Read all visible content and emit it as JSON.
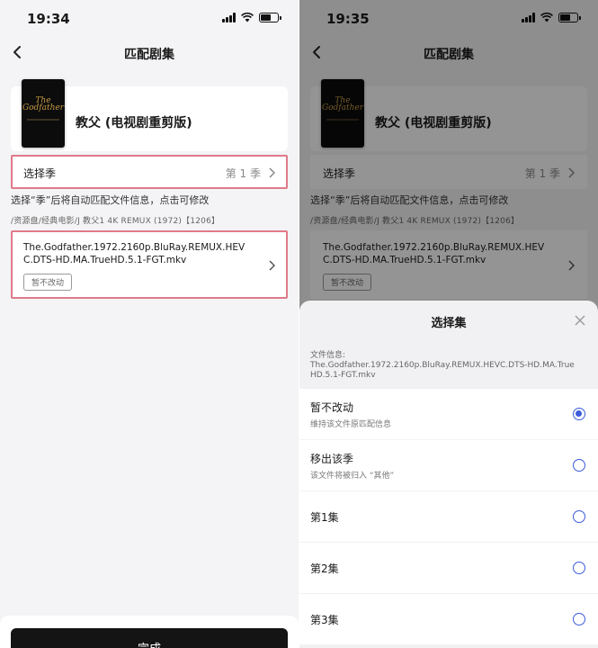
{
  "left": {
    "time": "19:34",
    "nav_title": "匹配剧集",
    "show_title": "教父 (电视剧重剪版)",
    "poster_text": "The Godfather",
    "season_label": "选择季",
    "season_value": "第 1 季",
    "hint": "选择“季”后将自动匹配文件信息，点击可修改",
    "path": "/资源盘/经典电影/J 教父1 4K REMUX (1972)【1206】",
    "filename": "The.Godfather.1972.2160p.BluRay.REMUX.HEVC.DTS-HD.MA.TrueHD.5.1-FGT.mkv",
    "file_badge": "暂不改动",
    "done_label": "完成"
  },
  "right": {
    "time": "19:35",
    "nav_title": "匹配剧集",
    "show_title": "教父 (电视剧重剪版)",
    "poster_text": "The Godfather",
    "season_label": "选择季",
    "season_value": "第 1 季",
    "hint": "选择“季”后将自动匹配文件信息，点击可修改",
    "path": "/资源盘/经典电影/J 教父1 4K REMUX (1972)【1206】",
    "filename": "The.Godfather.1972.2160p.BluRay.REMUX.HEVC.DTS-HD.MA.TrueHD.5.1-FGT.mkv",
    "file_badge": "暂不改动",
    "sheet": {
      "title": "选择集",
      "info_label": "文件信息:",
      "info_value": "The.Godfather.1972.2160p.BluRay.REMUX.HEVC.DTS-HD.MA.TrueHD.5.1-FGT.mkv",
      "options": [
        {
          "title": "暂不改动",
          "subtitle": "维持该文件原匹配信息",
          "selected": true
        },
        {
          "title": "移出该季",
          "subtitle": "该文件将被归入 “其他”",
          "selected": false
        },
        {
          "title": "第1集",
          "subtitle": "",
          "selected": false
        },
        {
          "title": "第2集",
          "subtitle": "",
          "selected": false
        },
        {
          "title": "第3集",
          "subtitle": "",
          "selected": false
        }
      ]
    }
  },
  "icons": {
    "back": "chevron-left-icon",
    "chevron": "chevron-right-icon",
    "close": "close-icon",
    "signal": "signal-icon",
    "wifi": "wifi-icon",
    "battery": "battery-icon"
  },
  "colors": {
    "highlight_border": "#e07a8a",
    "radio_accent": "#3b5bdb",
    "button_bg": "#141414",
    "poster_gold": "#c79a45"
  }
}
